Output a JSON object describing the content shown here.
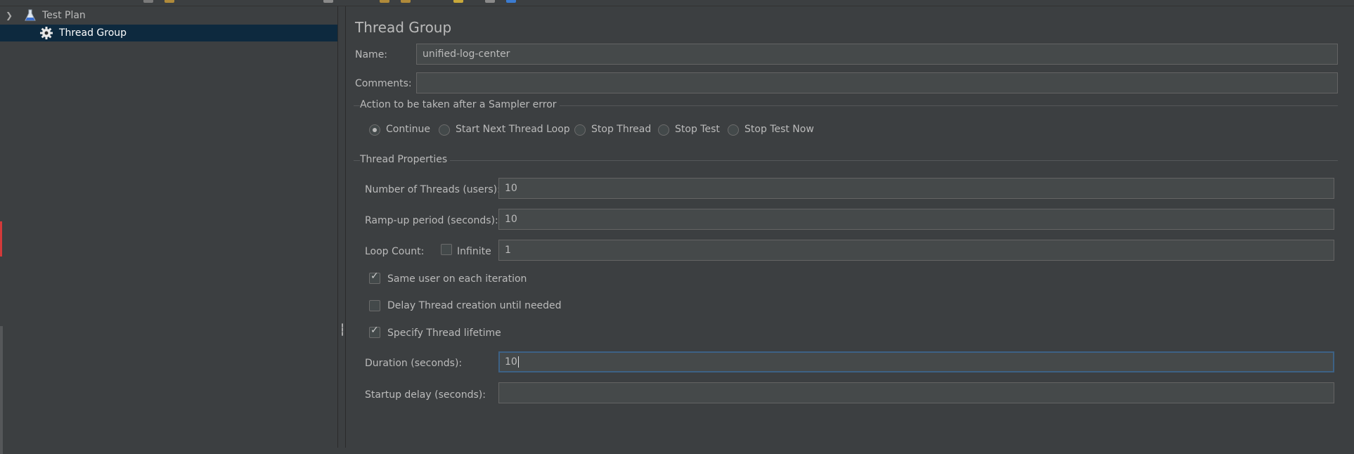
{
  "tree": {
    "items": [
      {
        "label": "Test Plan",
        "icon": "flask-icon",
        "expanded": true
      },
      {
        "label": "Thread Group",
        "icon": "gear-icon",
        "selected": true
      }
    ]
  },
  "panel": {
    "title": "Thread Group",
    "name_label": "Name:",
    "name_value": "unified-log-center",
    "comments_label": "Comments:",
    "comments_value": ""
  },
  "sampler_error": {
    "group_title": "Action to be taken after a Sampler error",
    "options": [
      {
        "label": "Continue",
        "selected": true
      },
      {
        "label": "Start Next Thread Loop",
        "selected": false
      },
      {
        "label": "Stop Thread",
        "selected": false
      },
      {
        "label": "Stop Test",
        "selected": false
      },
      {
        "label": "Stop Test Now",
        "selected": false
      }
    ]
  },
  "thread_props": {
    "group_title": "Thread Properties",
    "num_threads_label": "Number of Threads (users):",
    "num_threads_value": "10",
    "ramp_up_label": "Ramp-up period (seconds):",
    "ramp_up_value": "10",
    "loop_count_label": "Loop Count:",
    "infinite_label": "Infinite",
    "infinite_checked": false,
    "loop_count_value": "1",
    "same_user_label": "Same user on each iteration",
    "same_user_checked": true,
    "delay_creation_label": "Delay Thread creation until needed",
    "delay_creation_checked": false,
    "specify_lifetime_label": "Specify Thread lifetime",
    "specify_lifetime_checked": true,
    "duration_label": "Duration (seconds):",
    "duration_value": "10",
    "startup_delay_label": "Startup delay (seconds):",
    "startup_delay_value": ""
  },
  "colors": {
    "background": "#3c3f41",
    "field_bg": "#45494a",
    "selection": "#0d293e",
    "focus_border": "#3d6185"
  }
}
